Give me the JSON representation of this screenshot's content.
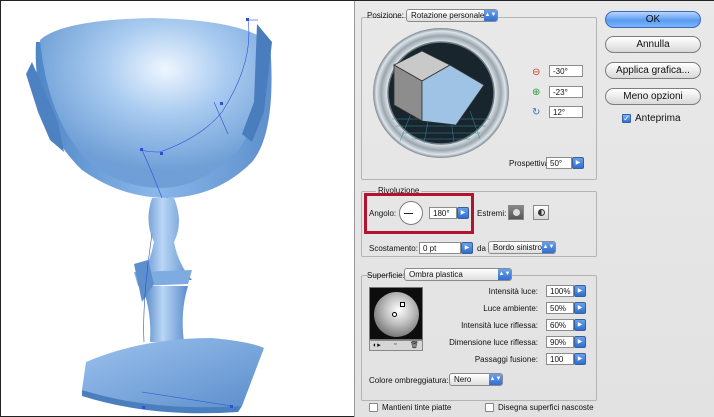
{
  "posizione": {
    "label": "Posizione:",
    "preset": "Rotazione personale",
    "rotation_x": "-30°",
    "rotation_y": "-23°",
    "rotation_z": "12°",
    "prospettiva_label": "Prospettiva:",
    "prospettiva_value": "50°"
  },
  "buttons": {
    "ok": "OK",
    "annulla": "Annulla",
    "applica": "Applica grafica...",
    "meno_opzioni": "Meno opzioni",
    "anteprima": "Anteprima",
    "anteprima_checked": true
  },
  "rivoluzione": {
    "title": "Rivoluzione",
    "angolo_label": "Angolo:",
    "angolo_value": "180°",
    "estremi_label": "Estremi:",
    "scostamento_label": "Scostamento:",
    "scostamento_value": "0 pt",
    "da_label": "da",
    "da_value": "Bordo sinistro"
  },
  "superficie": {
    "label": "Superficie:",
    "value": "Ombra plastica",
    "intensita_luce_label": "Intensità luce:",
    "intensita_luce_value": "100%",
    "luce_ambiente_label": "Luce ambiente:",
    "luce_ambiente_value": "50%",
    "intensita_riflessa_label": "Intensità luce riflessa:",
    "intensita_riflessa_value": "60%",
    "dimensione_riflessa_label": "Dimensione luce riflessa:",
    "dimensione_riflessa_value": "90%",
    "passaggi_label": "Passaggi fusione:",
    "passaggi_value": "100",
    "colore_label": "Colore ombreggiatura:",
    "colore_value": "Nero",
    "mantieni_label": "Mantieni tinte piatte",
    "disegna_label": "Disegna superfici nascoste"
  },
  "colors": {
    "accent": "#2f6fd1",
    "highlight": "#b4132f",
    "goblet": "#7aa8dc"
  }
}
